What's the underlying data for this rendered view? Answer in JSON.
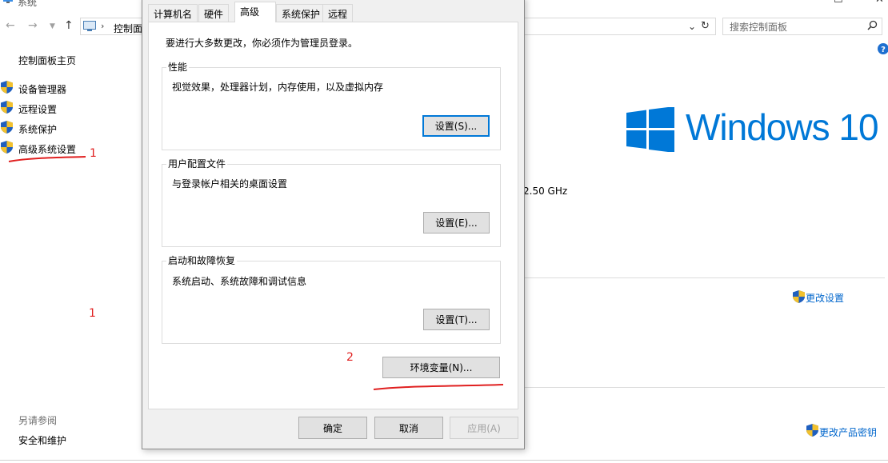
{
  "window": {
    "title": "系统",
    "address_label": "控制面",
    "search_placeholder": "搜索控制面板",
    "controls": {
      "minimize": "—",
      "maximize": "☐",
      "close": "✕"
    }
  },
  "left_panel": {
    "home": "控制面板主页",
    "items": [
      {
        "label": "设备管理器",
        "icon": "shield-icon"
      },
      {
        "label": "远程设置",
        "icon": "shield-icon"
      },
      {
        "label": "系统保护",
        "icon": "shield-icon"
      },
      {
        "label": "高级系统设置",
        "icon": "shield-icon"
      }
    ],
    "see_also_title": "另请参阅",
    "see_also_link": "安全和维护"
  },
  "right_panel": {
    "windows_logo_text": "Windows 10",
    "cpu_speed": "2.50 GHz",
    "change_settings": "更改设置",
    "change_product_key": "更改产品密钥"
  },
  "annotations": {
    "mark_1a": "1",
    "mark_1b": "1",
    "mark_2": "2",
    "color": "#e02020"
  },
  "dialog": {
    "tabs": [
      "计算机名",
      "硬件",
      "高级",
      "系统保护",
      "远程"
    ],
    "active_tab": "高级",
    "admin_note": "要进行大多数更改，你必须作为管理员登录。",
    "groups": {
      "performance": {
        "title": "性能",
        "desc": "视觉效果，处理器计划，内存使用，以及虚拟内存",
        "button": "设置(S)..."
      },
      "profiles": {
        "title": "用户配置文件",
        "desc": "与登录帐户相关的桌面设置",
        "button": "设置(E)..."
      },
      "startup": {
        "title": "启动和故障恢复",
        "desc": "系统启动、系统故障和调试信息",
        "button": "设置(T)..."
      }
    },
    "env_button": "环境变量(N)...",
    "ok": "确定",
    "cancel": "取消",
    "apply": "应用(A)"
  },
  "colors": {
    "windows_blue": "#0078d7",
    "annotation_red": "#e02020"
  }
}
